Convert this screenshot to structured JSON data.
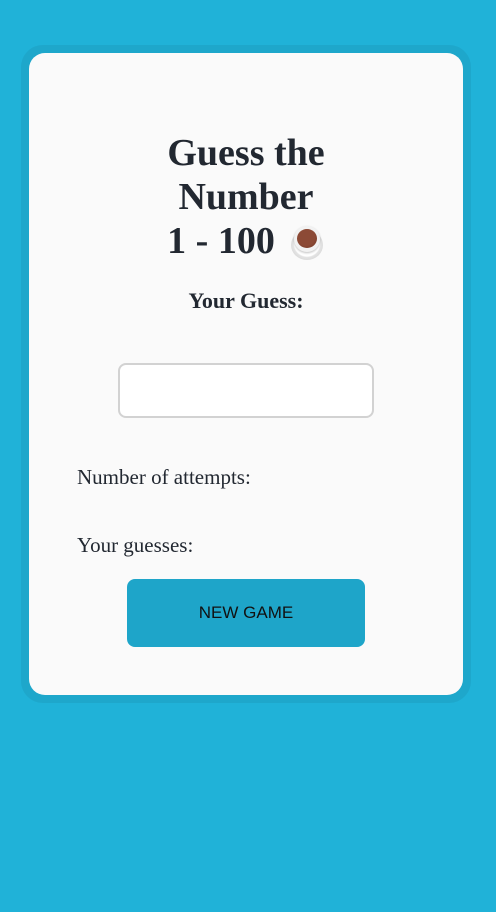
{
  "game": {
    "title_line1": "Guess the",
    "title_line2": "Number",
    "range": "1 - 100",
    "title_icon": "coffee-cup-icon",
    "guess_label": "Your Guess:",
    "guess_value": "",
    "attempts_label": "Number of attempts:",
    "guesses_label": "Your guesses:",
    "new_game_label": "NEW GAME"
  },
  "colors": {
    "background": "#20b2d8",
    "card": "#fafafa",
    "button": "#1ea5c9",
    "text": "#222831"
  }
}
